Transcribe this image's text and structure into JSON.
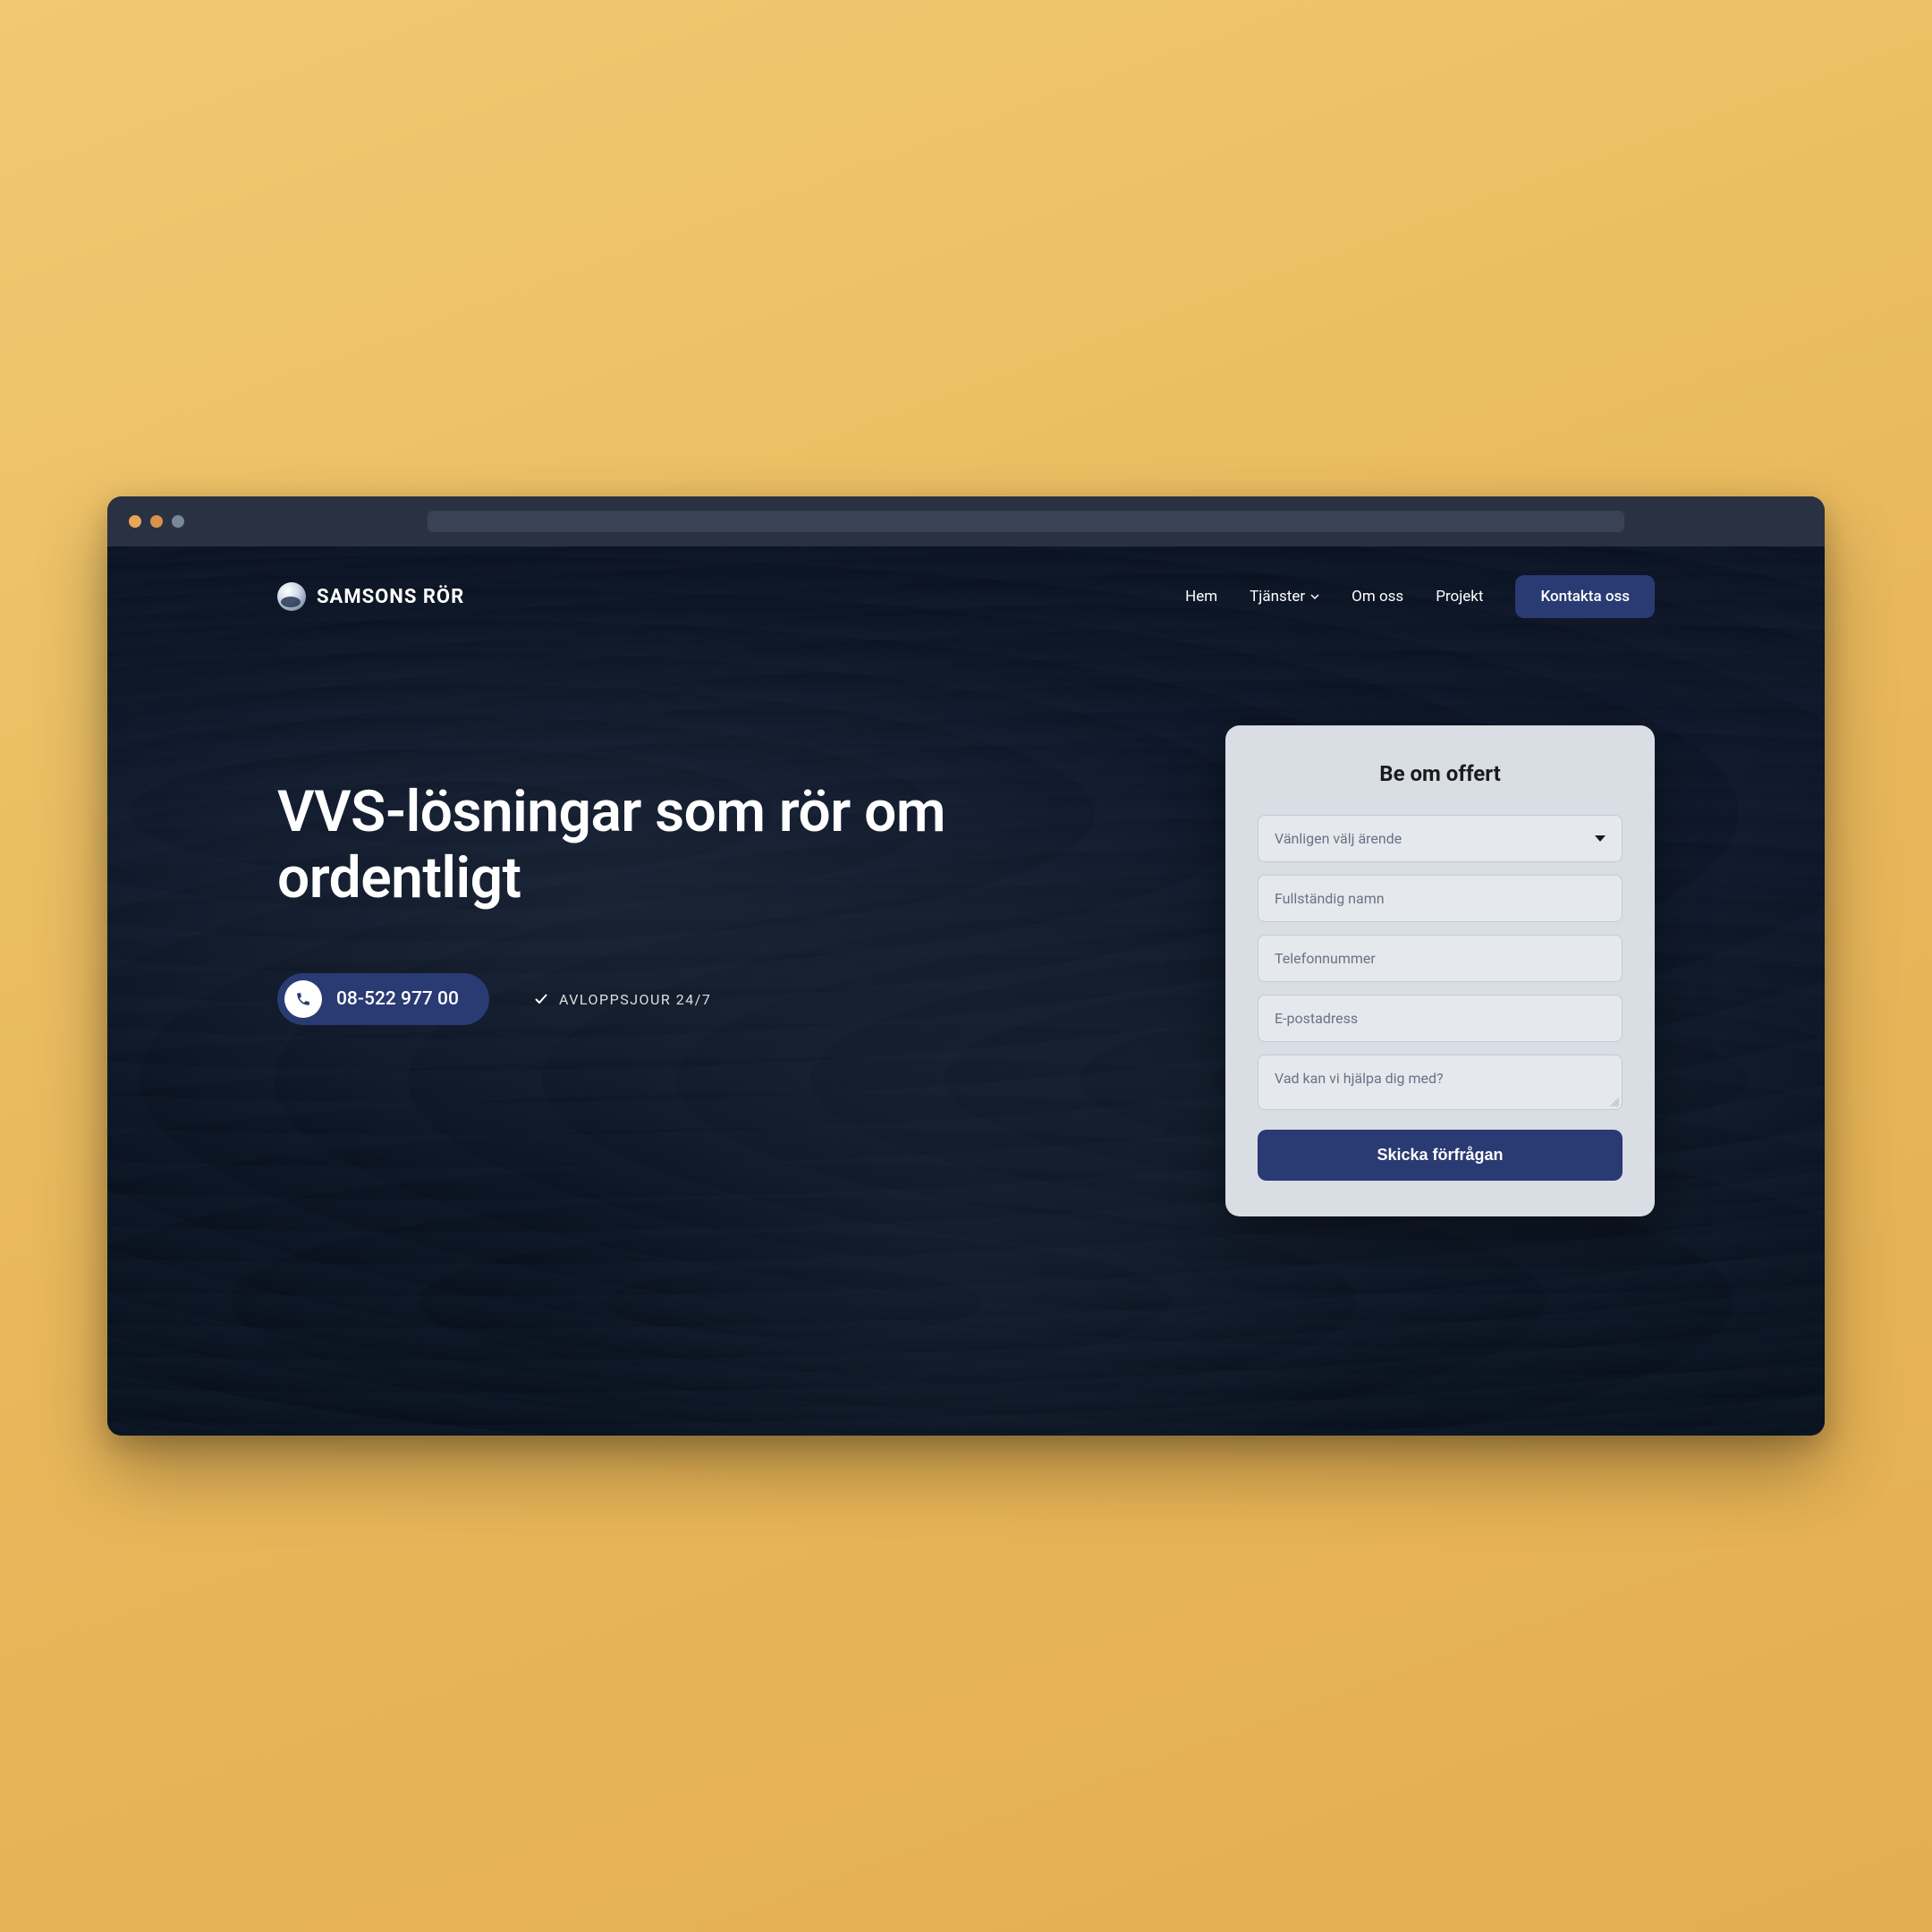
{
  "brand": {
    "name": "SAMSONS RÖR"
  },
  "nav": {
    "items": [
      {
        "label": "Hem"
      },
      {
        "label": "Tjänster",
        "hasDropdown": true
      },
      {
        "label": "Om oss"
      },
      {
        "label": "Projekt"
      }
    ],
    "cta": "Kontakta oss"
  },
  "hero": {
    "title": "VVS-lösningar som rör om ordentligt",
    "phone": "08-522 977 00",
    "availability": "AVLOPPSJOUR 24/7"
  },
  "form": {
    "title": "Be om offert",
    "selectPlaceholder": "Vänligen välj ärende",
    "namePlaceholder": "Fullständig namn",
    "phonePlaceholder": "Telefonnummer",
    "emailPlaceholder": "E-postadress",
    "messagePlaceholder": "Vad kan vi hjälpa dig med?",
    "submit": "Skicka förfrågan"
  },
  "colors": {
    "primary": "#2a3a72",
    "formBg": "#d9dde4",
    "pageBg": "#0a1220"
  }
}
